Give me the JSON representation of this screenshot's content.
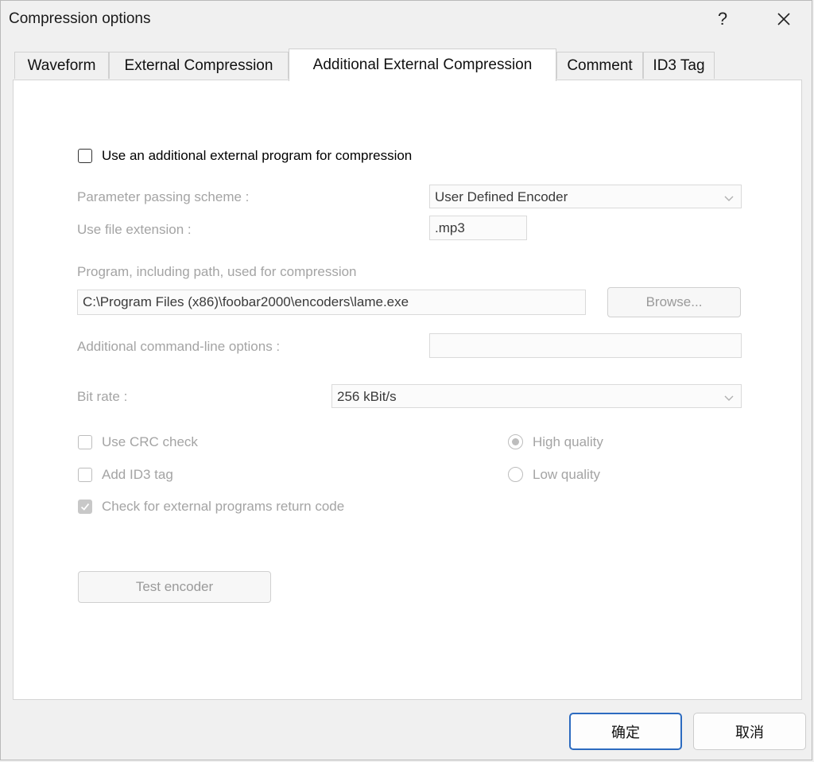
{
  "window": {
    "title": "Compression options",
    "help_glyph": "?",
    "close_glyph": "✕"
  },
  "tabs": [
    {
      "label": "Waveform",
      "active": false
    },
    {
      "label": "External Compression",
      "active": false
    },
    {
      "label": "Additional External Compression",
      "active": true
    },
    {
      "label": "Comment",
      "active": false
    },
    {
      "label": "ID3 Tag",
      "active": false
    }
  ],
  "panel": {
    "use_additional_label": "Use an additional external program for compression",
    "use_additional_checked": false,
    "param_scheme_label": "Parameter passing scheme :",
    "param_scheme_value": "User Defined Encoder",
    "file_ext_label": "Use file extension :",
    "file_ext_value": ".mp3",
    "program_label": "Program, including path, used for compression",
    "program_value": "C:\\Program Files (x86)\\foobar2000\\encoders\\lame.exe",
    "browse_label": "Browse...",
    "cmdline_label": "Additional command-line options :",
    "cmdline_value": "",
    "bitrate_label": "Bit rate :",
    "bitrate_value": "256 kBit/s",
    "crc_label": "Use CRC check",
    "crc_checked": false,
    "id3_label": "Add ID3 tag",
    "id3_checked": false,
    "return_code_label": "Check for external programs return code",
    "return_code_checked": true,
    "high_quality_label": "High quality",
    "high_quality_selected": true,
    "low_quality_label": "Low quality",
    "low_quality_selected": false,
    "test_encoder_label": "Test encoder"
  },
  "footer": {
    "ok_label": "确定",
    "cancel_label": "取消"
  },
  "colors": {
    "accent": "#2c6bc0",
    "disabled_text": "#a4a4a4"
  }
}
